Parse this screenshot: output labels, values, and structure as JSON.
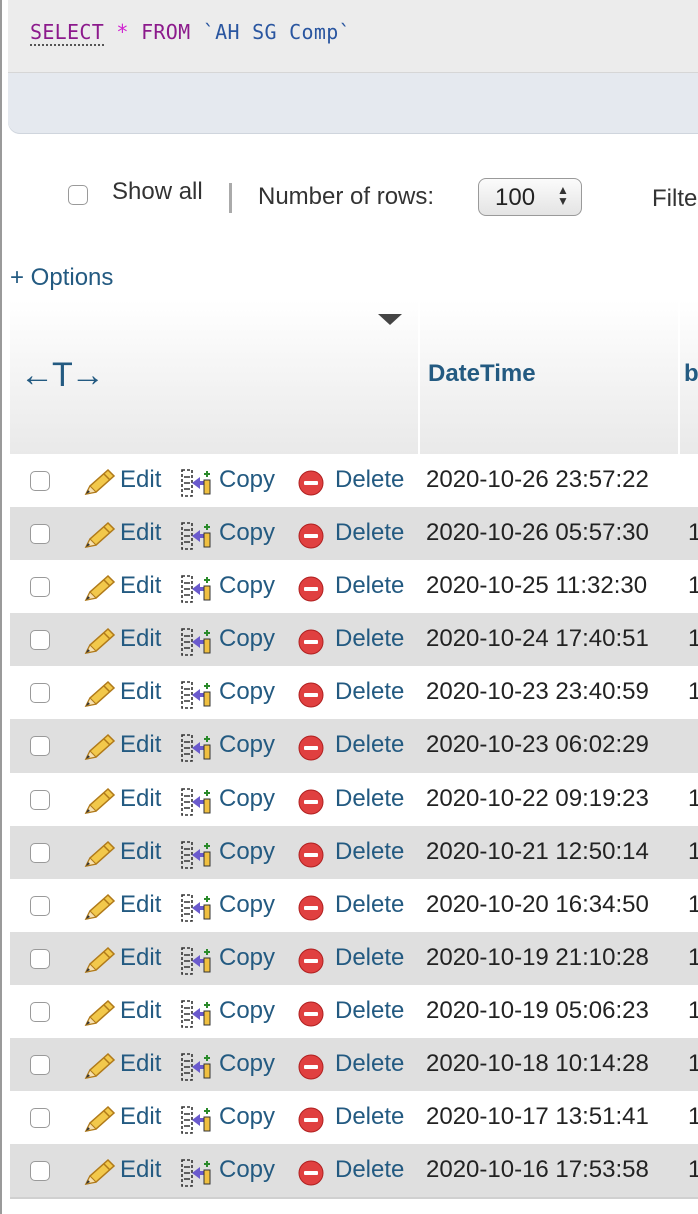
{
  "query": {
    "select_kw": "SELECT",
    "star": "*",
    "from_kw": "FROM",
    "table": "`AH SG Comp`"
  },
  "controls": {
    "show_all_label": "Show all",
    "rows_label": "Number of rows:",
    "rows_value": "100",
    "filter_label": "Filte"
  },
  "options_link": "+ Options",
  "table": {
    "resize_glyph": "←T→",
    "col_datetime": "DateTime",
    "col_next_partial": "b",
    "action_labels": {
      "edit": "Edit",
      "copy": "Copy",
      "delete": "Delete"
    },
    "rows": [
      {
        "datetime": "2020-10-26 23:57:22",
        "next": ""
      },
      {
        "datetime": "2020-10-26 05:57:30",
        "next": "1"
      },
      {
        "datetime": "2020-10-25 11:32:30",
        "next": "1"
      },
      {
        "datetime": "2020-10-24 17:40:51",
        "next": "1"
      },
      {
        "datetime": "2020-10-23 23:40:59",
        "next": "1"
      },
      {
        "datetime": "2020-10-23 06:02:29",
        "next": ""
      },
      {
        "datetime": "2020-10-22 09:19:23",
        "next": "1"
      },
      {
        "datetime": "2020-10-21 12:50:14",
        "next": "1"
      },
      {
        "datetime": "2020-10-20 16:34:50",
        "next": "1"
      },
      {
        "datetime": "2020-10-19 21:10:28",
        "next": "1"
      },
      {
        "datetime": "2020-10-19 05:06:23",
        "next": "1"
      },
      {
        "datetime": "2020-10-18 10:14:28",
        "next": "1"
      },
      {
        "datetime": "2020-10-17 13:51:41",
        "next": "1"
      },
      {
        "datetime": "2020-10-16 17:53:58",
        "next": "1"
      }
    ]
  },
  "icons": {
    "edit": "pencil-icon",
    "copy": "copy-row-icon",
    "delete": "delete-icon",
    "sort": "sort-triangle-icon"
  },
  "colors": {
    "link": "#235a81",
    "keyword": "#8c1a8c",
    "star": "#d020d0",
    "row_alt": "#dfdfdf",
    "delete_red": "#e04040"
  }
}
